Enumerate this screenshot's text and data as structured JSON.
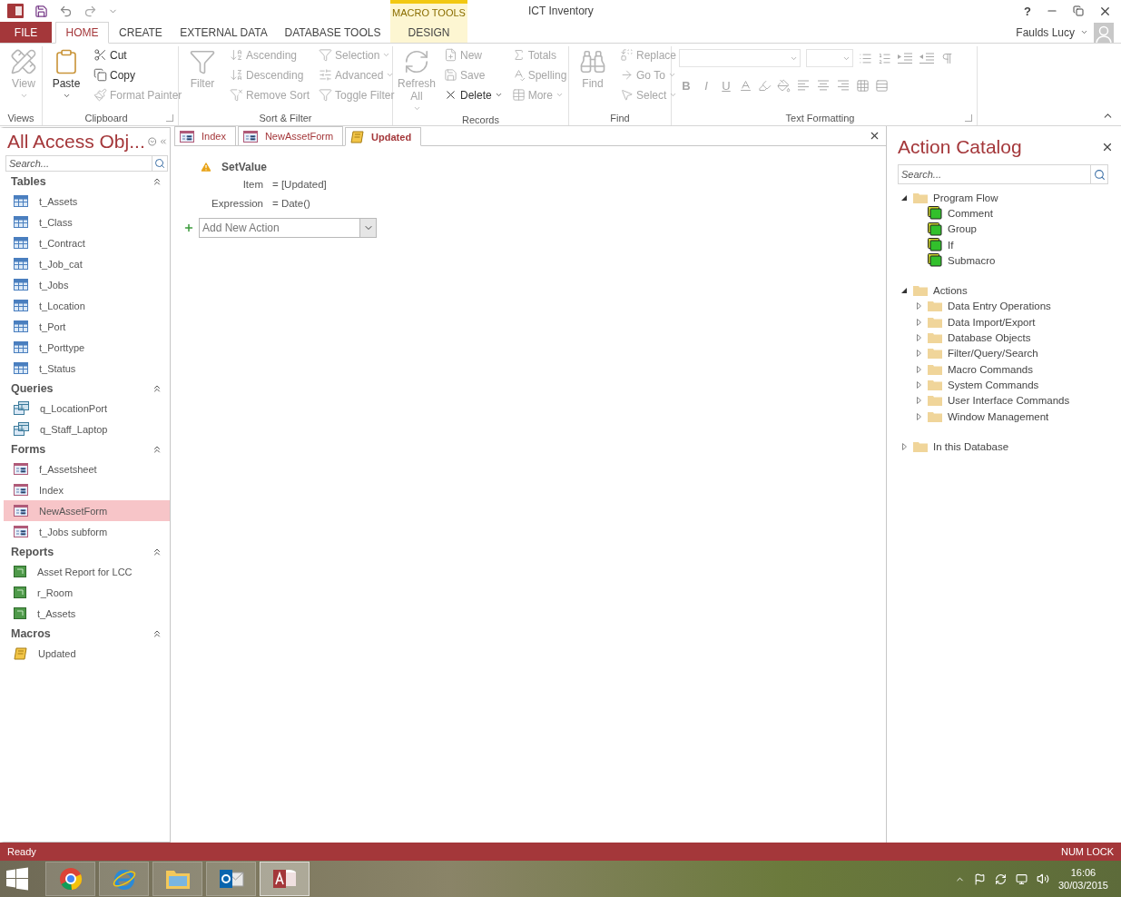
{
  "title_bar": {
    "title": "ICT Inventory",
    "context_group": "MACRO TOOLS",
    "help_label": "?"
  },
  "ribbon_tabs": [
    {
      "label": "FILE",
      "kind": "file",
      "selected": false
    },
    {
      "label": "HOME",
      "kind": "normal",
      "selected": true
    },
    {
      "label": "CREATE",
      "kind": "normal",
      "selected": false
    },
    {
      "label": "EXTERNAL DATA",
      "kind": "normal",
      "selected": false
    },
    {
      "label": "DATABASE TOOLS",
      "kind": "normal",
      "selected": false
    },
    {
      "label": "DESIGN",
      "kind": "context",
      "selected": false
    }
  ],
  "user": {
    "name": "Faulds Lucy"
  },
  "ribbon_groups": [
    {
      "label": "Views",
      "kind": "commands",
      "launcher": false,
      "columns": [
        [
          {
            "kind": "large",
            "label": "View",
            "disabled": true,
            "dropdown": true
          }
        ]
      ]
    },
    {
      "label": "Clipboard",
      "kind": "commands",
      "launcher": true,
      "columns": [
        [
          {
            "kind": "large",
            "label": "Paste",
            "disabled": false,
            "dropdown": true
          }
        ],
        [
          {
            "kind": "small",
            "label": "Cut",
            "disabled": false,
            "dropdown": false
          },
          {
            "kind": "small",
            "label": "Copy",
            "disabled": false,
            "dropdown": false
          },
          {
            "kind": "small",
            "label": "Format Painter",
            "disabled": true,
            "dropdown": false
          }
        ]
      ]
    },
    {
      "label": "Sort & Filter",
      "kind": "commands",
      "launcher": false,
      "columns": [
        [
          {
            "kind": "large",
            "label": "Filter",
            "disabled": true,
            "dropdown": false
          }
        ],
        [
          {
            "kind": "small",
            "label": "Ascending",
            "disabled": true,
            "dropdown": false
          },
          {
            "kind": "small",
            "label": "Descending",
            "disabled": true,
            "dropdown": false
          },
          {
            "kind": "small",
            "label": "Remove Sort",
            "disabled": true,
            "dropdown": false
          }
        ],
        [
          {
            "kind": "small",
            "label": "Selection",
            "disabled": true,
            "dropdown": true
          },
          {
            "kind": "small",
            "label": "Advanced",
            "disabled": true,
            "dropdown": true
          },
          {
            "kind": "small",
            "label": "Toggle Filter",
            "disabled": true,
            "dropdown": false
          }
        ]
      ]
    },
    {
      "label": "Records",
      "kind": "commands",
      "launcher": false,
      "columns": [
        [
          {
            "kind": "large",
            "label": "Refresh All",
            "disabled": true,
            "dropdown": true
          }
        ],
        [
          {
            "kind": "small",
            "label": "New",
            "disabled": true,
            "dropdown": false
          },
          {
            "kind": "small",
            "label": "Save",
            "disabled": true,
            "dropdown": false
          },
          {
            "kind": "small",
            "label": "Delete",
            "disabled": false,
            "dropdown": true
          }
        ],
        [
          {
            "kind": "small",
            "label": "Totals",
            "disabled": true,
            "dropdown": false
          },
          {
            "kind": "small",
            "label": "Spelling",
            "disabled": true,
            "dropdown": false
          },
          {
            "kind": "small",
            "label": "More",
            "disabled": true,
            "dropdown": true
          }
        ]
      ]
    },
    {
      "label": "Find",
      "kind": "commands",
      "launcher": false,
      "columns": [
        [
          {
            "kind": "large",
            "label": "Find",
            "disabled": true,
            "dropdown": false
          }
        ],
        [
          {
            "kind": "small",
            "label": "Replace",
            "disabled": true,
            "dropdown": false
          },
          {
            "kind": "small",
            "label": "Go To",
            "disabled": true,
            "dropdown": true
          },
          {
            "kind": "small",
            "label": "Select",
            "disabled": true,
            "dropdown": true
          }
        ]
      ]
    },
    {
      "label": "Text Formatting",
      "kind": "text_formatting",
      "launcher": true,
      "format_buttons": [
        "B",
        "I",
        "U"
      ]
    }
  ],
  "nav_pane": {
    "title": "All Access Obj...",
    "search_placeholder": "Search...",
    "groups": [
      {
        "label": "Tables",
        "kind": "table",
        "expanded": true,
        "items": [
          {
            "label": "t_Assets",
            "selected": false
          },
          {
            "label": "t_Class",
            "selected": false
          },
          {
            "label": "t_Contract",
            "selected": false
          },
          {
            "label": "t_Job_cat",
            "selected": false
          },
          {
            "label": "t_Jobs",
            "selected": false
          },
          {
            "label": "t_Location",
            "selected": false
          },
          {
            "label": "t_Port",
            "selected": false
          },
          {
            "label": "t_Porttype",
            "selected": false
          },
          {
            "label": "t_Status",
            "selected": false
          }
        ]
      },
      {
        "label": "Queries",
        "kind": "query",
        "expanded": true,
        "items": [
          {
            "label": "q_LocationPort",
            "selected": false
          },
          {
            "label": "q_Staff_Laptop",
            "selected": false
          }
        ]
      },
      {
        "label": "Forms",
        "kind": "form",
        "expanded": true,
        "items": [
          {
            "label": "f_Assetsheet",
            "selected": false
          },
          {
            "label": "Index",
            "selected": false
          },
          {
            "label": "NewAssetForm",
            "selected": true
          },
          {
            "label": "t_Jobs subform",
            "selected": false
          }
        ]
      },
      {
        "label": "Reports",
        "kind": "report",
        "expanded": true,
        "items": [
          {
            "label": "Asset Report for LCC",
            "selected": false
          },
          {
            "label": "r_Room",
            "selected": false
          },
          {
            "label": "t_Assets",
            "selected": false
          }
        ]
      },
      {
        "label": "Macros",
        "kind": "macro",
        "expanded": true,
        "items": [
          {
            "label": "Updated",
            "selected": false
          }
        ]
      }
    ]
  },
  "document_tabs": [
    {
      "label": "Index",
      "kind": "form",
      "selected": false
    },
    {
      "label": "NewAssetForm",
      "kind": "form",
      "selected": false
    },
    {
      "label": "Updated",
      "kind": "macro",
      "selected": true
    }
  ],
  "macro": {
    "action": "SetValue",
    "arguments": [
      {
        "name": "Item",
        "value": "= [Updated]"
      },
      {
        "name": "Expression",
        "value": "= Date()"
      }
    ],
    "add_action_placeholder": "Add New Action"
  },
  "action_catalog": {
    "title": "Action Catalog",
    "search_placeholder": "Search...",
    "tree": [
      {
        "label": "Program Flow",
        "kind": "folder",
        "expanded": true,
        "children": [
          {
            "label": "Comment",
            "kind": "action"
          },
          {
            "label": "Group",
            "kind": "action"
          },
          {
            "label": "If",
            "kind": "action"
          },
          {
            "label": "Submacro",
            "kind": "action"
          }
        ]
      },
      {
        "label": "Actions",
        "kind": "folder",
        "expanded": true,
        "children": [
          {
            "label": "Data Entry Operations",
            "kind": "folder",
            "expanded": false
          },
          {
            "label": "Data Import/Export",
            "kind": "folder",
            "expanded": false
          },
          {
            "label": "Database Objects",
            "kind": "folder",
            "expanded": false
          },
          {
            "label": "Filter/Query/Search",
            "kind": "folder",
            "expanded": false
          },
          {
            "label": "Macro Commands",
            "kind": "folder",
            "expanded": false
          },
          {
            "label": "System Commands",
            "kind": "folder",
            "expanded": false
          },
          {
            "label": "User Interface Commands",
            "kind": "folder",
            "expanded": false
          },
          {
            "label": "Window Management",
            "kind": "folder",
            "expanded": false
          }
        ]
      },
      {
        "label": "In this Database",
        "kind": "folder",
        "expanded": false
      }
    ]
  },
  "status_bar": {
    "left": "Ready",
    "right": "NUM LOCK"
  },
  "taskbar": {
    "apps": [
      {
        "kind": "browser_round",
        "selected": false
      },
      {
        "kind": "browser_e",
        "selected": false
      },
      {
        "kind": "files",
        "selected": false
      },
      {
        "kind": "mail",
        "selected": false
      },
      {
        "kind": "database",
        "selected": true
      }
    ],
    "time": "16:06",
    "date": "30/03/2015"
  }
}
